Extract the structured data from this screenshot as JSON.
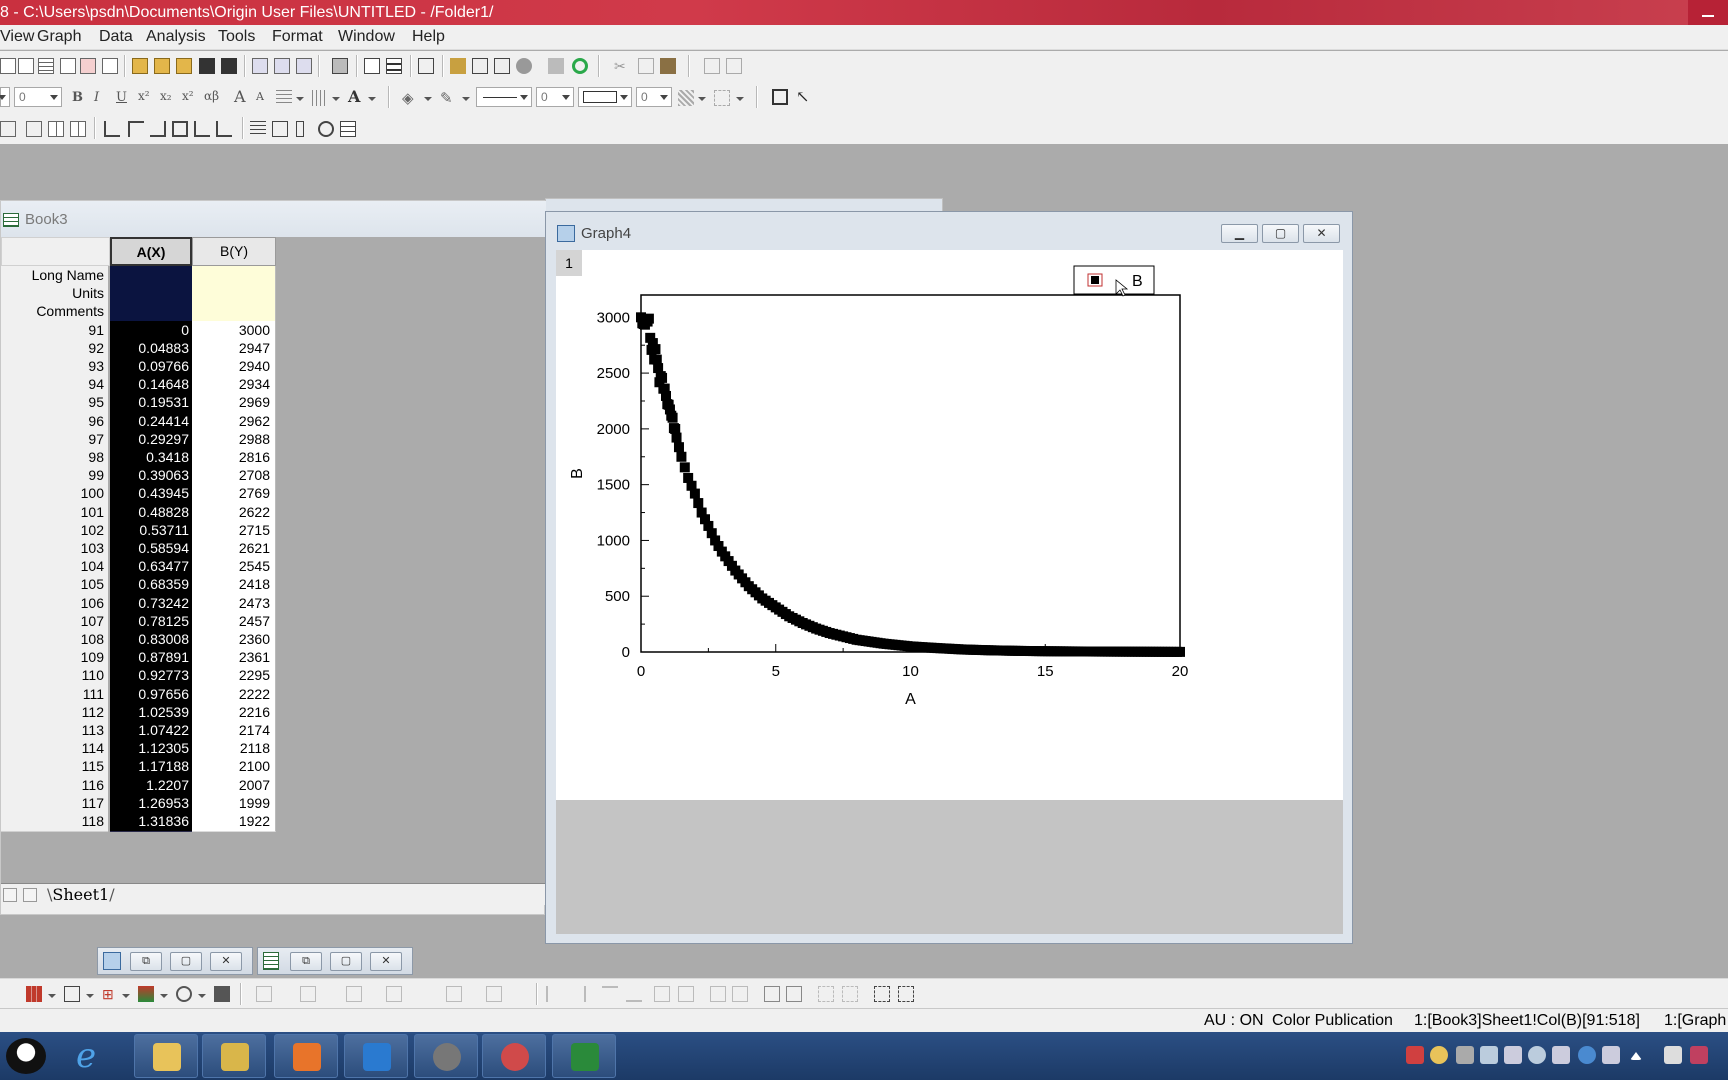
{
  "window": {
    "title": "8 - C:\\Users\\psdn\\Documents\\Origin User Files\\UNTITLED - /Folder1/"
  },
  "menu": [
    "View",
    "Graph",
    "Data",
    "Analysis",
    "Tools",
    "Format",
    "Window",
    "Help"
  ],
  "toolbar": {
    "font_size": "0",
    "line_width": "0",
    "pattern_width": "0"
  },
  "book": {
    "title": "Book3",
    "col_a": "A(X)",
    "col_b": "B(Y)",
    "meta_labels": [
      "Long Name",
      "Units",
      "Comments"
    ],
    "rows": [
      {
        "n": "91",
        "a": "0",
        "b": "3000"
      },
      {
        "n": "92",
        "a": "0.04883",
        "b": "2947"
      },
      {
        "n": "93",
        "a": "0.09766",
        "b": "2940"
      },
      {
        "n": "94",
        "a": "0.14648",
        "b": "2934"
      },
      {
        "n": "95",
        "a": "0.19531",
        "b": "2969"
      },
      {
        "n": "96",
        "a": "0.24414",
        "b": "2962"
      },
      {
        "n": "97",
        "a": "0.29297",
        "b": "2988"
      },
      {
        "n": "98",
        "a": "0.3418",
        "b": "2816"
      },
      {
        "n": "99",
        "a": "0.39063",
        "b": "2708"
      },
      {
        "n": "100",
        "a": "0.43945",
        "b": "2769"
      },
      {
        "n": "101",
        "a": "0.48828",
        "b": "2622"
      },
      {
        "n": "102",
        "a": "0.53711",
        "b": "2715"
      },
      {
        "n": "103",
        "a": "0.58594",
        "b": "2621"
      },
      {
        "n": "104",
        "a": "0.63477",
        "b": "2545"
      },
      {
        "n": "105",
        "a": "0.68359",
        "b": "2418"
      },
      {
        "n": "106",
        "a": "0.73242",
        "b": "2473"
      },
      {
        "n": "107",
        "a": "0.78125",
        "b": "2457"
      },
      {
        "n": "108",
        "a": "0.83008",
        "b": "2360"
      },
      {
        "n": "109",
        "a": "0.87891",
        "b": "2361"
      },
      {
        "n": "110",
        "a": "0.92773",
        "b": "2295"
      },
      {
        "n": "111",
        "a": "0.97656",
        "b": "2222"
      },
      {
        "n": "112",
        "a": "1.02539",
        "b": "2216"
      },
      {
        "n": "113",
        "a": "1.07422",
        "b": "2174"
      },
      {
        "n": "114",
        "a": "1.12305",
        "b": "2118"
      },
      {
        "n": "115",
        "a": "1.17188",
        "b": "2100"
      },
      {
        "n": "116",
        "a": "1.2207",
        "b": "2007"
      },
      {
        "n": "117",
        "a": "1.26953",
        "b": "1999"
      },
      {
        "n": "118",
        "a": "1.31836",
        "b": "1922"
      }
    ],
    "sheet_tab": "Sheet1"
  },
  "graph": {
    "title": "Graph4",
    "layer": "1"
  },
  "chart_data": {
    "type": "scatter",
    "title": "",
    "xlabel": "A",
    "ylabel": "B",
    "xlim": [
      0,
      20
    ],
    "ylim": [
      0,
      3200
    ],
    "xticks": [
      "0",
      "5",
      "10",
      "15",
      "20"
    ],
    "yticks": [
      "0",
      "500",
      "1000",
      "1500",
      "2000",
      "2500",
      "3000"
    ],
    "legend": {
      "entries": [
        "B"
      ],
      "position": "top-right"
    },
    "marker": "filled-square",
    "series": [
      {
        "name": "B",
        "x": [
          0,
          0.04883,
          0.09766,
          0.14648,
          0.19531,
          0.24414,
          0.29297,
          0.3418,
          0.39063,
          0.43945,
          0.48828,
          0.53711,
          0.58594,
          0.63477,
          0.68359,
          0.73242,
          0.78125,
          0.83008,
          0.87891,
          0.92773,
          0.97656,
          1.02539,
          1.07422,
          1.12305,
          1.17188,
          1.2207,
          1.26953,
          1.31836,
          1.5,
          1.75,
          2,
          2.25,
          2.5,
          2.75,
          3,
          3.5,
          4,
          4.5,
          5,
          5.5,
          6,
          6.5,
          7,
          7.5,
          8,
          9,
          10,
          11,
          12,
          13,
          14,
          15,
          16,
          17,
          18,
          19,
          20
        ],
        "y": [
          3000,
          2947,
          2940,
          2934,
          2969,
          2962,
          2988,
          2816,
          2708,
          2769,
          2622,
          2715,
          2621,
          2545,
          2418,
          2473,
          2457,
          2360,
          2361,
          2295,
          2222,
          2216,
          2174,
          2118,
          2100,
          2007,
          1999,
          1922,
          1750,
          1560,
          1420,
          1250,
          1130,
          1000,
          900,
          730,
          590,
          480,
          400,
          320,
          260,
          210,
          170,
          140,
          110,
          75,
          50,
          35,
          22,
          15,
          10,
          7,
          5,
          4,
          3,
          2,
          1
        ]
      }
    ]
  },
  "status": {
    "au": "AU : ON",
    "mode": "Color Publication",
    "cell": "1:[Book3]Sheet1!Col(B)[91:518]",
    "graph": "1:[Graph"
  },
  "colors": {
    "titlebar": "#c9303f",
    "selected_column": "#000000",
    "meta_b": "#fefdd9",
    "taskbar": "#1c3a66"
  }
}
